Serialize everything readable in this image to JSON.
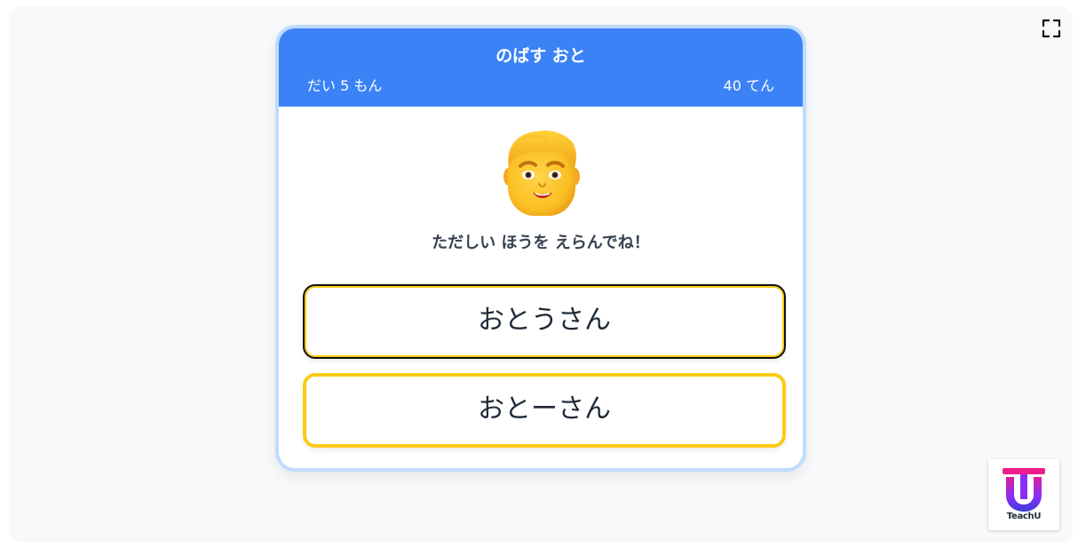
{
  "header": {
    "title": "のばす おと",
    "question_number": "だい 5 もん",
    "score": "40 てん"
  },
  "avatar": {
    "icon": "man-face-icon"
  },
  "instruction": "ただしい ほうを えらんでね！",
  "choices": [
    {
      "label": "おとうさん",
      "state": "focused"
    },
    {
      "label": "おとーさん",
      "state": "default"
    }
  ],
  "logo": {
    "text": "TeachU"
  },
  "colors": {
    "header": "#3b82f6",
    "card_border": "#bfdbfe",
    "choice_border": "#facc15",
    "background": "#f8f9fb"
  }
}
